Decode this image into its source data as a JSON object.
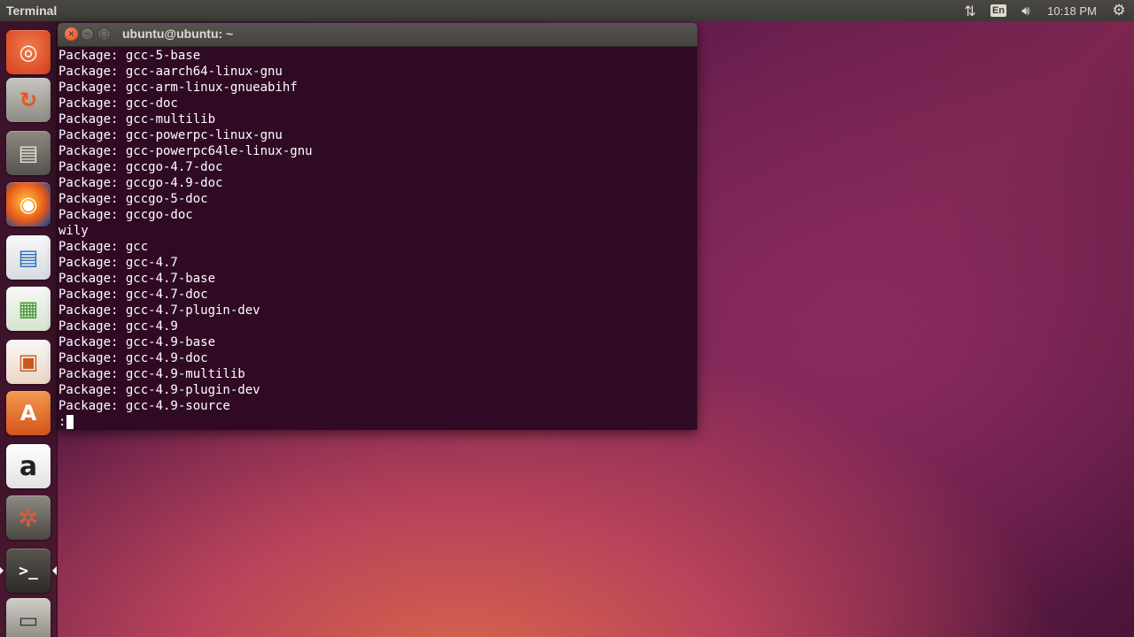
{
  "top_panel": {
    "app_title": "Terminal",
    "keyboard_layout": "En",
    "clock": "10:18 PM",
    "icons": [
      "network-icon",
      "keyboard-icon",
      "volume-icon",
      "gear-icon"
    ]
  },
  "launcher": {
    "items": [
      {
        "name": "dash",
        "glyph": "◎"
      },
      {
        "name": "software-updater",
        "glyph": "↻"
      },
      {
        "name": "files",
        "glyph": "▤"
      },
      {
        "name": "firefox",
        "glyph": "◉"
      },
      {
        "name": "libreoffice-writer",
        "glyph": "▤"
      },
      {
        "name": "libreoffice-calc",
        "glyph": "▦"
      },
      {
        "name": "libreoffice-impress",
        "glyph": "▣"
      },
      {
        "name": "ubuntu-software-center",
        "glyph": "A"
      },
      {
        "name": "amazon",
        "glyph": "a"
      },
      {
        "name": "system-settings",
        "glyph": "✲"
      },
      {
        "name": "terminal",
        "glyph": ">_"
      },
      {
        "name": "disk",
        "glyph": "▭"
      }
    ]
  },
  "terminal": {
    "title": "ubuntu@ubuntu: ~",
    "buttons": {
      "close": "×",
      "minimize": "−",
      "maximize": "□"
    },
    "lines": [
      "Package: gcc-5-base",
      "Package: gcc-aarch64-linux-gnu",
      "Package: gcc-arm-linux-gnueabihf",
      "Package: gcc-doc",
      "Package: gcc-multilib",
      "Package: gcc-powerpc-linux-gnu",
      "Package: gcc-powerpc64le-linux-gnu",
      "Package: gccgo-4.7-doc",
      "Package: gccgo-4.9-doc",
      "Package: gccgo-5-doc",
      "Package: gccgo-doc",
      "wily",
      "Package: gcc",
      "Package: gcc-4.7",
      "Package: gcc-4.7-base",
      "Package: gcc-4.7-doc",
      "Package: gcc-4.7-plugin-dev",
      "Package: gcc-4.9",
      "Package: gcc-4.9-base",
      "Package: gcc-4.9-doc",
      "Package: gcc-4.9-multilib",
      "Package: gcc-4.9-plugin-dev",
      "Package: gcc-4.9-source"
    ],
    "prompt": ":"
  },
  "colors": {
    "terminal_bg": "#300a24",
    "panel_bg": "#3c3b37",
    "close_button": "#df4b16"
  }
}
